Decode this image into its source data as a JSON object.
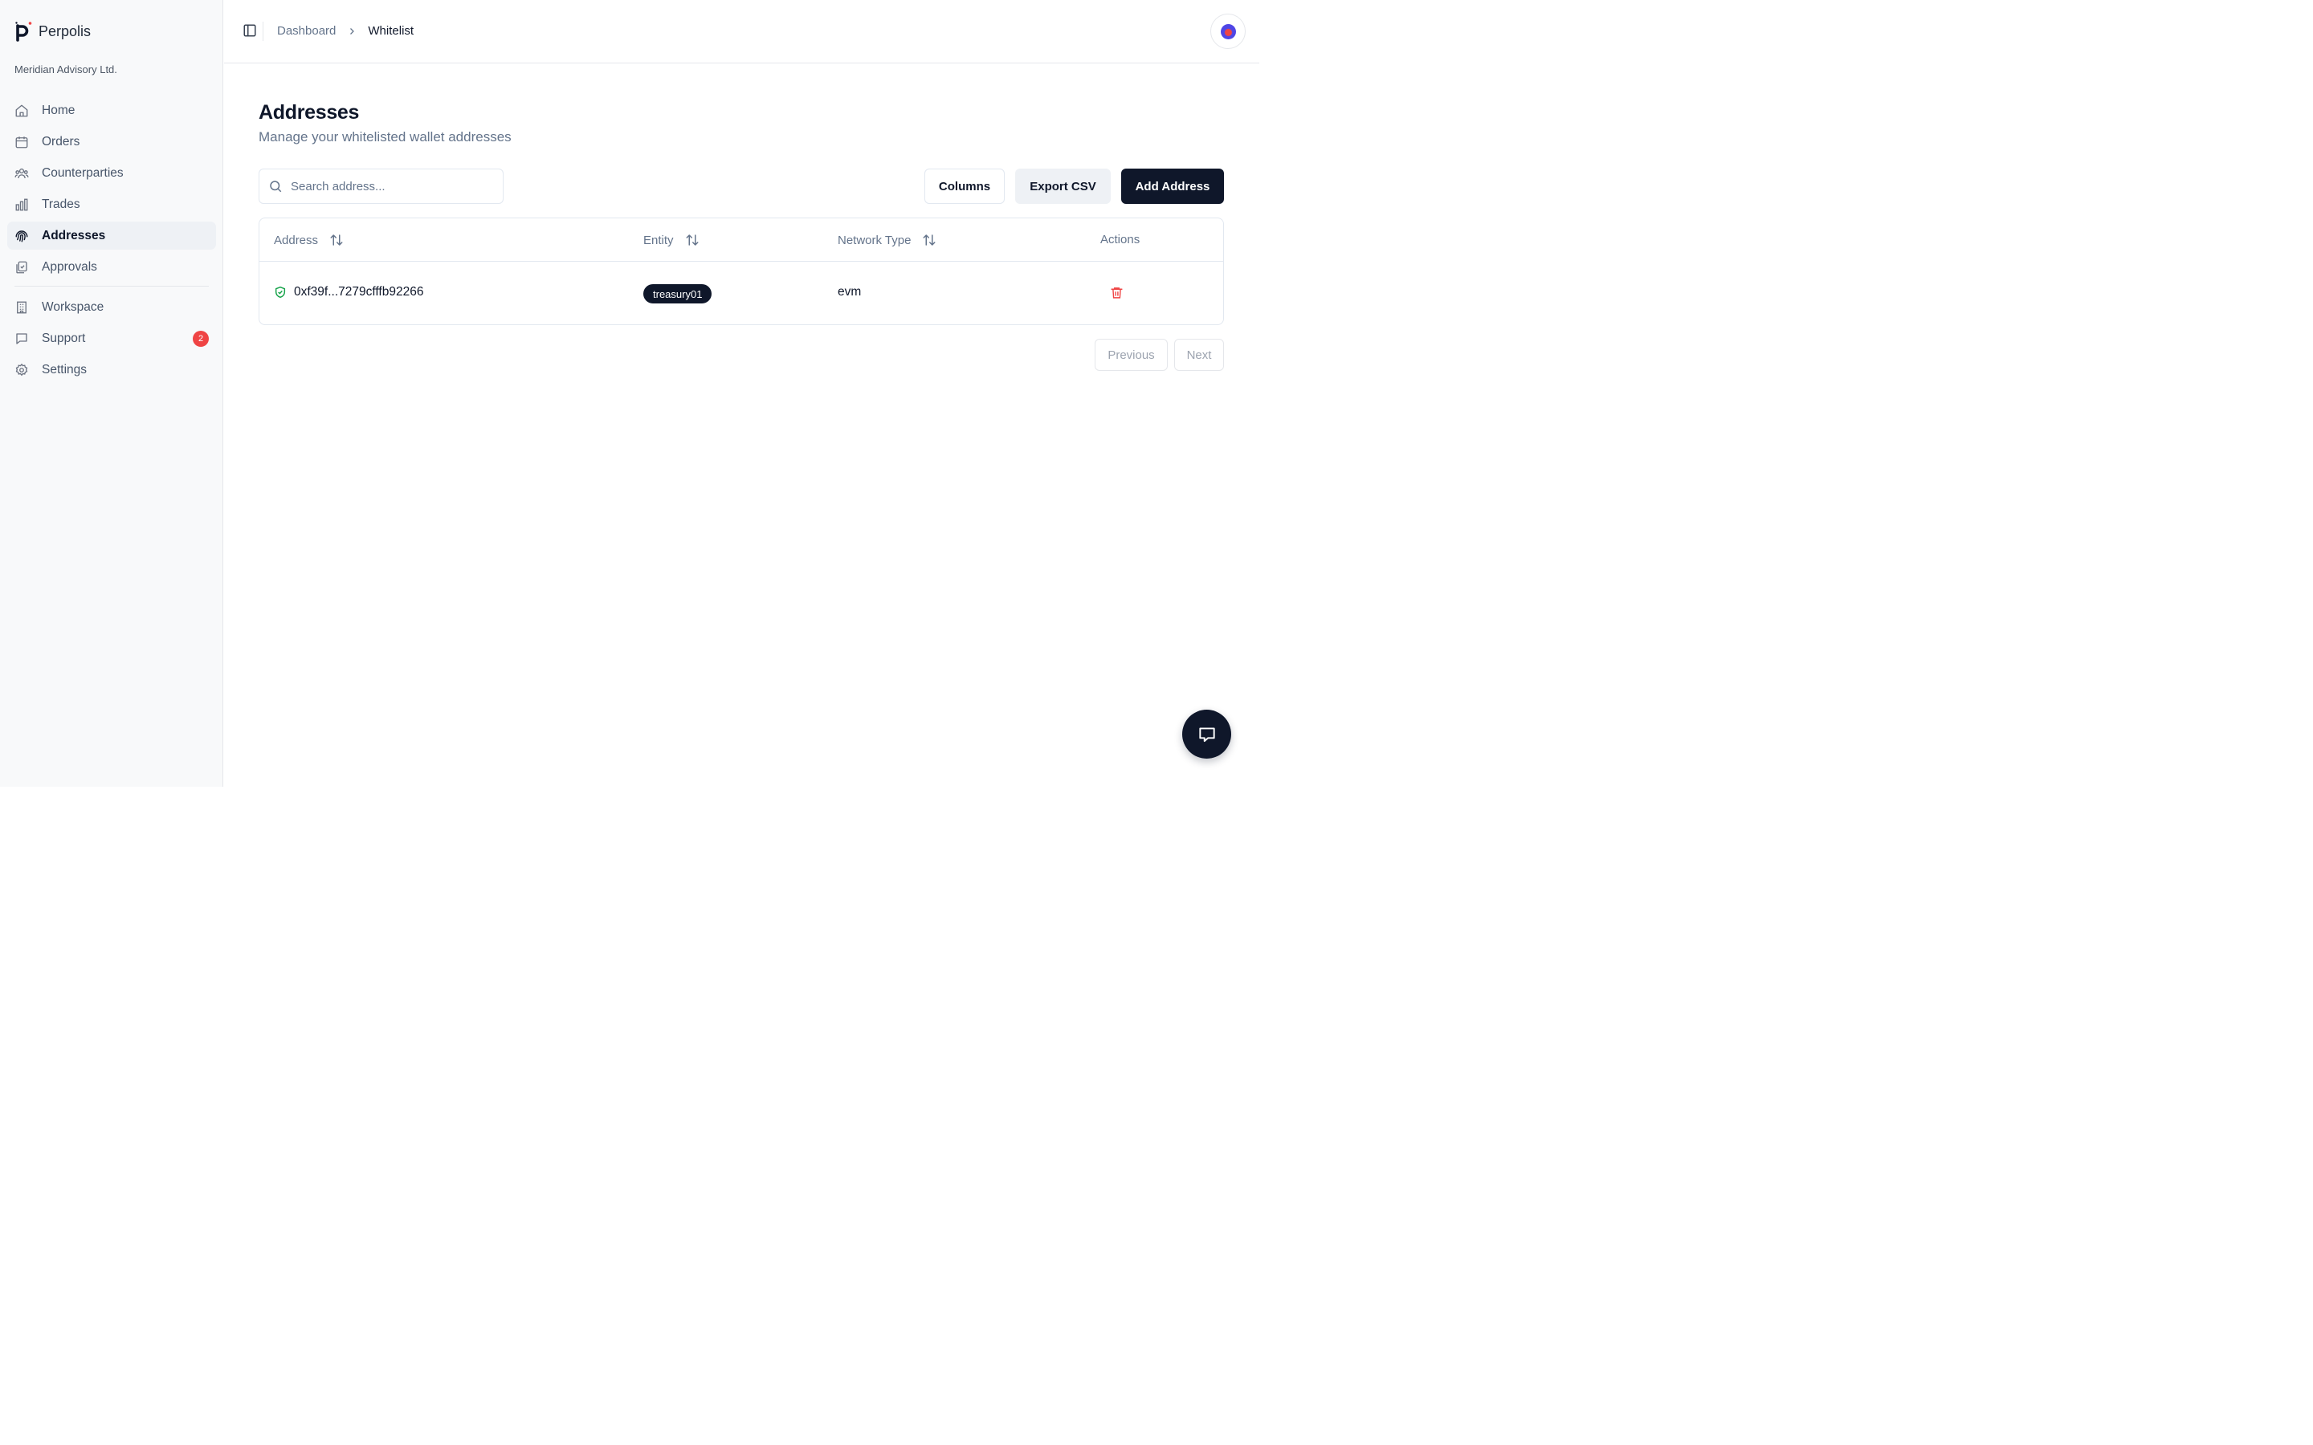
{
  "brand": {
    "name": "Perpolis",
    "org": "Meridian Advisory Ltd."
  },
  "sidebar": {
    "items": [
      {
        "label": "Home",
        "icon": "home-icon"
      },
      {
        "label": "Orders",
        "icon": "calendar-icon"
      },
      {
        "label": "Counterparties",
        "icon": "users-icon"
      },
      {
        "label": "Trades",
        "icon": "bar-chart-icon"
      },
      {
        "label": "Addresses",
        "icon": "fingerprint-icon",
        "active": true
      },
      {
        "label": "Approvals",
        "icon": "clipboard-check-icon"
      },
      {
        "label": "Workspace",
        "icon": "building-icon"
      },
      {
        "label": "Support",
        "icon": "message-square-icon",
        "badge": "2"
      },
      {
        "label": "Settings",
        "icon": "gear-icon"
      }
    ]
  },
  "header": {
    "breadcrumb": {
      "parent": "Dashboard",
      "current": "Whitelist"
    }
  },
  "main": {
    "title": "Addresses",
    "subtitle": "Manage your whitelisted wallet addresses",
    "search": {
      "placeholder": "Search address...",
      "value": ""
    },
    "buttons": {
      "columns": "Columns",
      "export": "Export CSV",
      "add": "Add Address"
    },
    "table": {
      "columns": [
        "Address",
        "Entity",
        "Network Type",
        "Actions"
      ],
      "rows": [
        {
          "address": "0xf39f...7279cfffb92266",
          "entity": "treasury01",
          "network": "evm"
        }
      ]
    },
    "pagination": {
      "previous": "Previous",
      "next": "Next"
    }
  },
  "colors": {
    "primary": "#0f172a",
    "muted": "#64748b",
    "danger": "#ef4444",
    "verified": "#16a34a",
    "sidebar_bg": "#f8f9fa"
  }
}
